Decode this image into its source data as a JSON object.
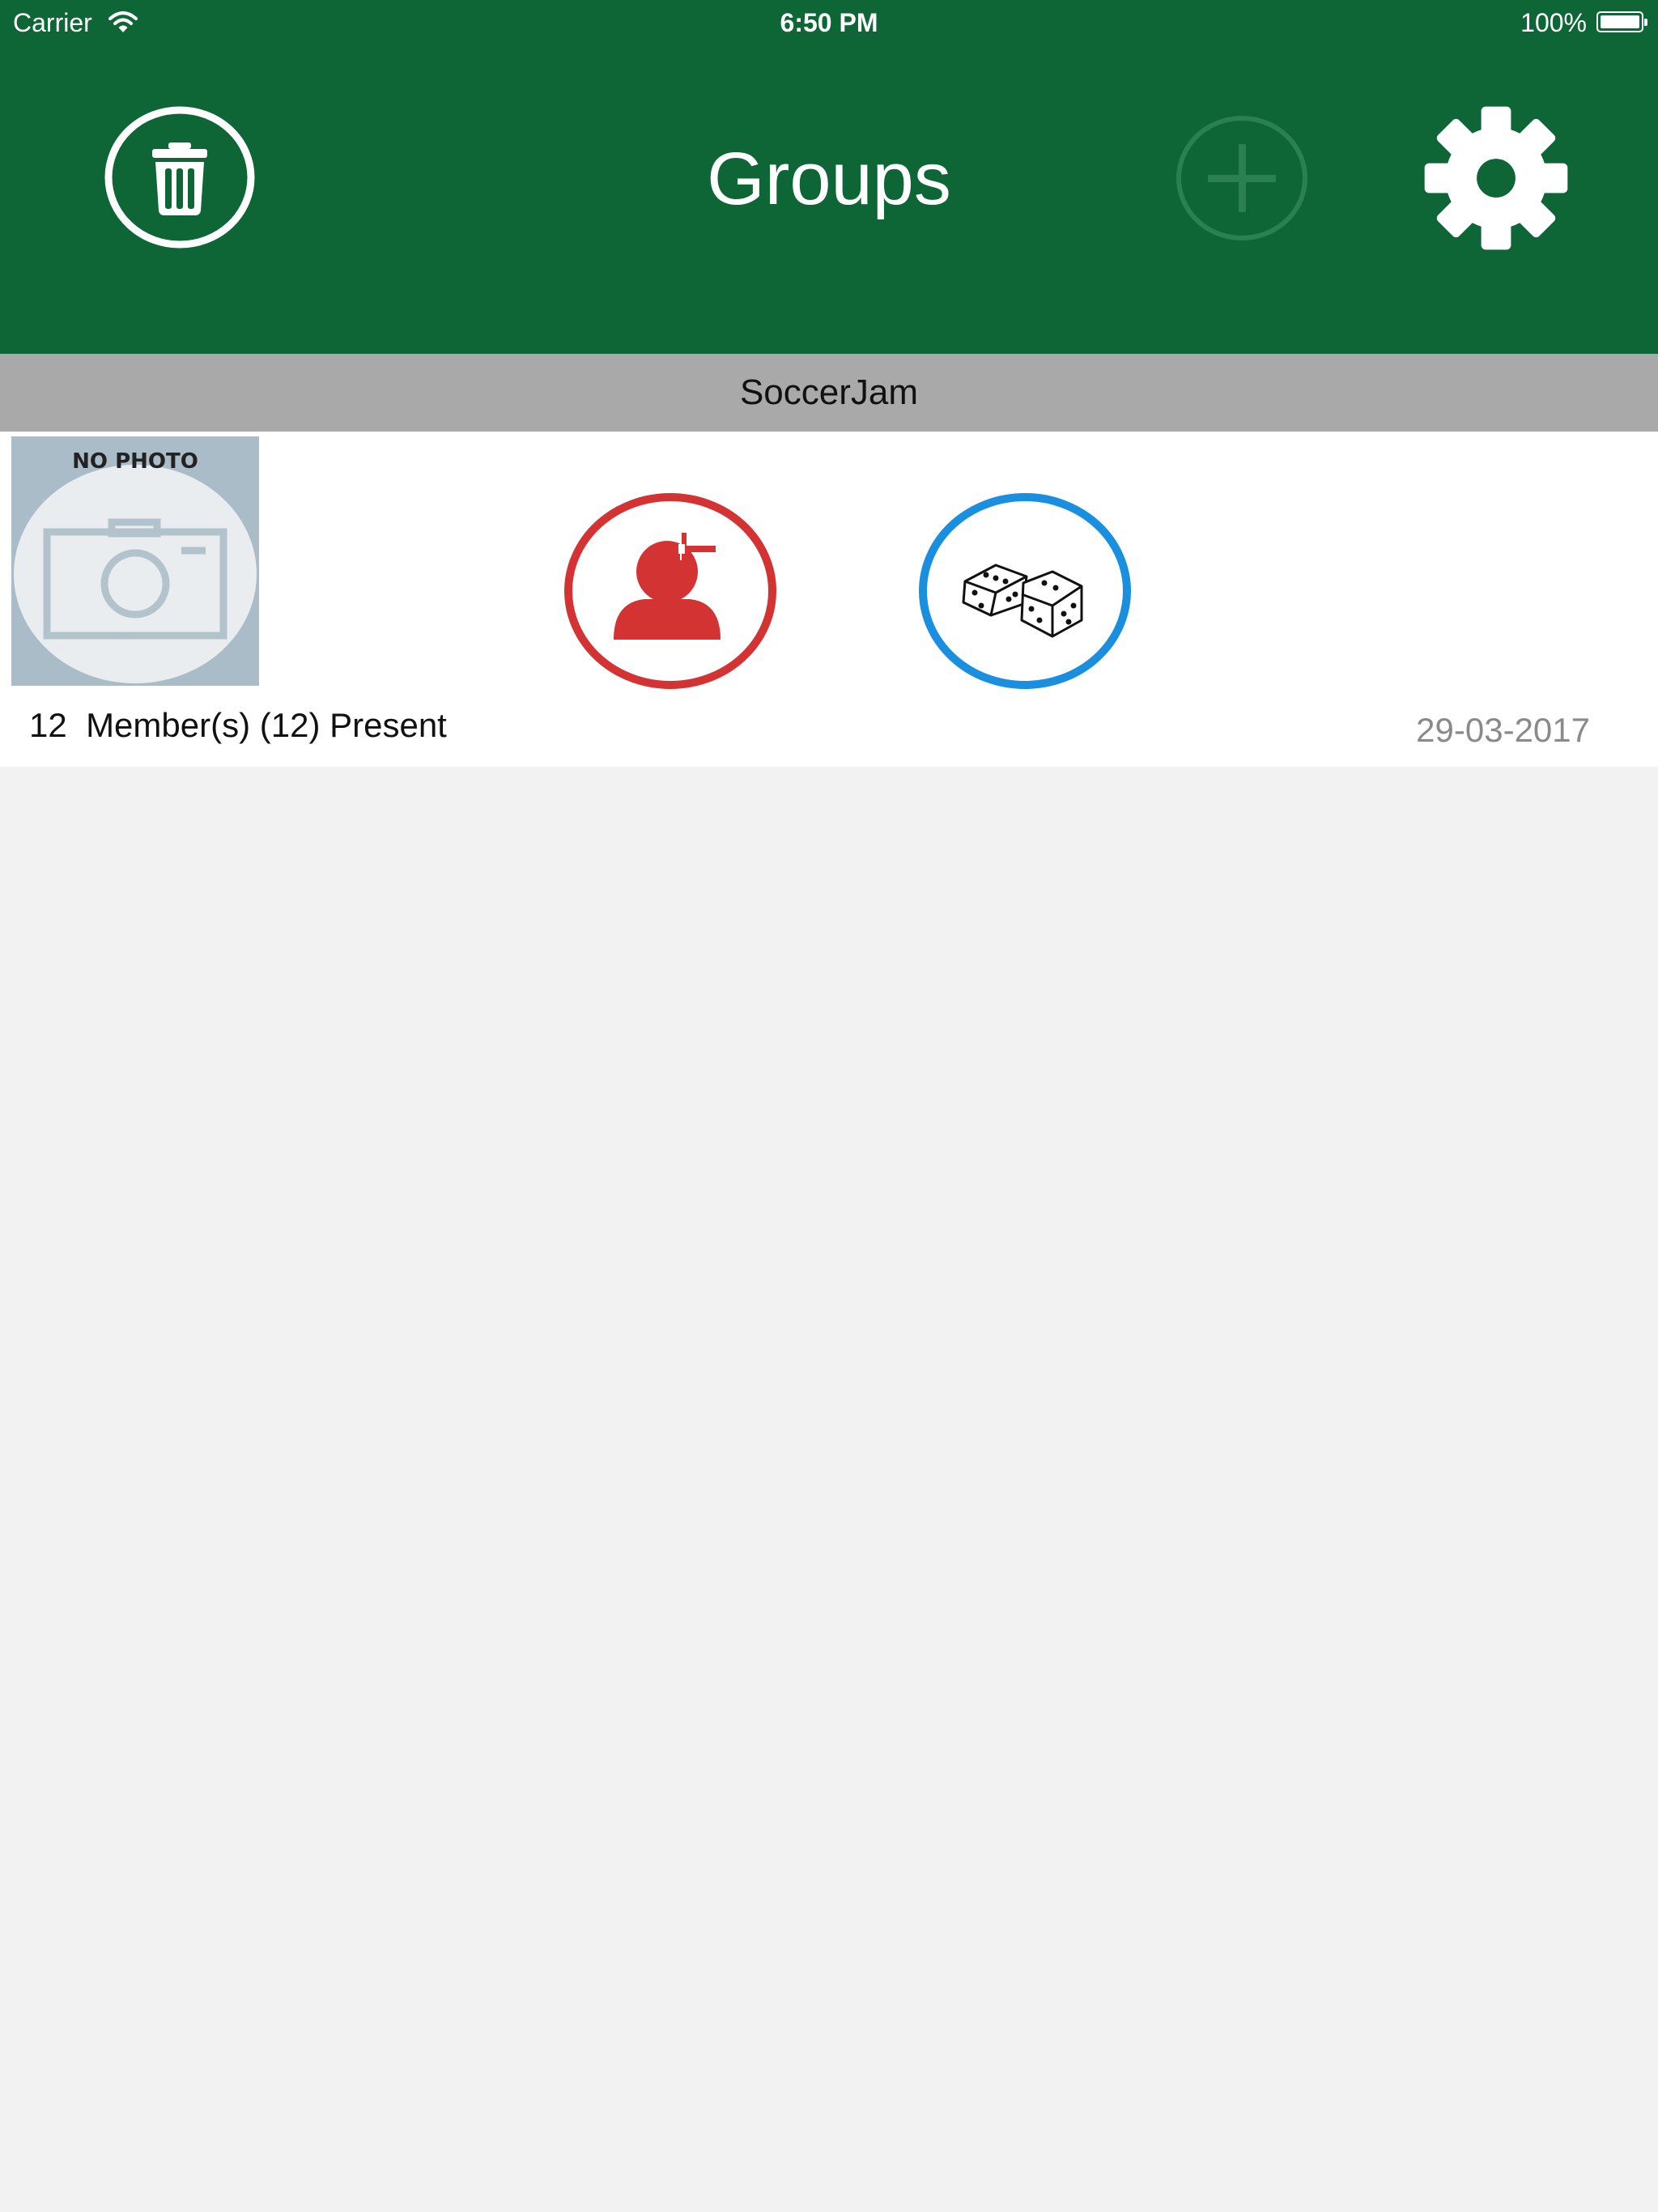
{
  "status_bar": {
    "carrier": "Carrier",
    "time": "6:50 PM",
    "battery": "100%"
  },
  "nav": {
    "title": "Groups",
    "left_icon": "trash-icon",
    "add_icon": "plus-circle-icon",
    "right_icon": "gear-icon"
  },
  "section": {
    "title": "SoccerJam"
  },
  "group": {
    "photo_label": "NO PHOTO",
    "member_count": "12",
    "members_text": "Member(s) (12) Present",
    "date": "29-03-2017",
    "member_icon": "add-member-icon",
    "random_icon": "dice-icon"
  },
  "colors": {
    "nav_bg": "#0e6636",
    "section_bg": "#a9a9a9",
    "member_button": "#d33333",
    "random_button": "#1a8fe0"
  }
}
